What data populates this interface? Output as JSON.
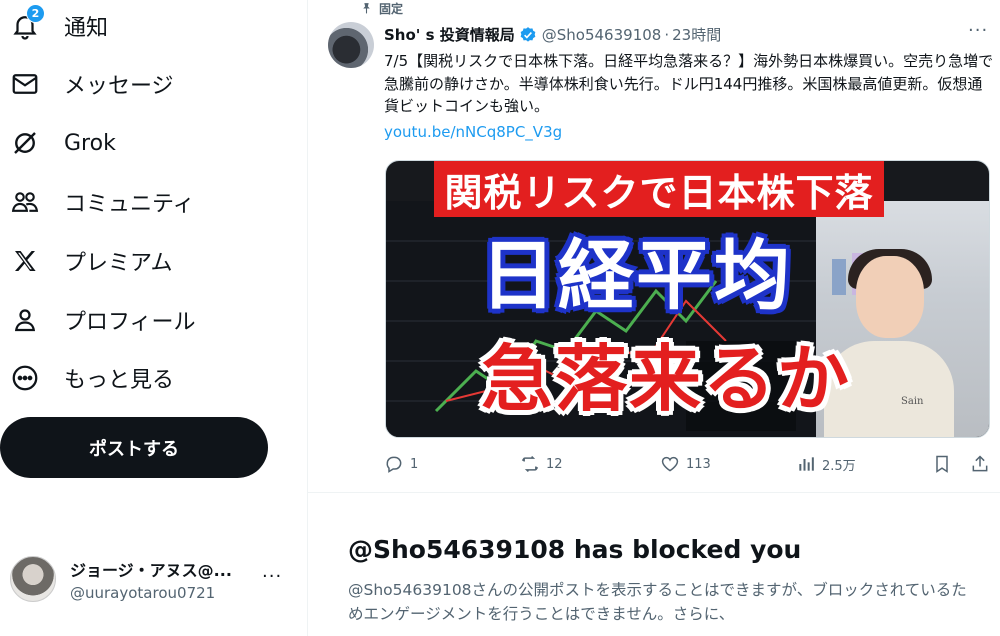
{
  "nav": {
    "notifications": {
      "label": "通知",
      "badge": "2",
      "icon": "bell-icon"
    },
    "messages": {
      "label": "メッセージ",
      "icon": "envelope-icon"
    },
    "grok": {
      "label": "Grok",
      "icon": "grok-icon"
    },
    "communities": {
      "label": "コミュニティ",
      "icon": "people-icon"
    },
    "premium": {
      "label": "プレミアム",
      "icon": "x-logo-icon"
    },
    "profile": {
      "label": "プロフィール",
      "icon": "person-icon"
    },
    "more": {
      "label": "もっと見る",
      "icon": "more-circle-icon"
    },
    "post_button": "ポストする"
  },
  "account": {
    "name": "ジョージ・アヌス@...",
    "handle": "@uurayotarou0721",
    "more": "···"
  },
  "tweet": {
    "pinned_label": "固定",
    "author_name": "Sho' s 投資情報局",
    "handle": "@Sho54639108",
    "dot": "·",
    "time": "23時間",
    "more": "···",
    "text": "7/5【関税リスクで日本株下落。日経平均急落来る？】海外勢日本株爆買い。空売り急増で急騰前の静けさか。半導体株利食い先行。ドル円144円推移。米国株最高値更新。仮想通貨ビットコインも強い。",
    "link": "youtu.be/nNCq8PC_V3g",
    "thumbnail": {
      "banner": "関税リスクで日本株下落",
      "line1": "日経平均",
      "line2": "急落来るか",
      "shirt": "Sain"
    },
    "stats": {
      "replies": "1",
      "reposts": "12",
      "likes": "113",
      "views": "2.5万"
    }
  },
  "blocked": {
    "title": "@Sho54639108 has blocked you",
    "text": "@Sho54639108さんの公開ポストを表示することはできますが、ブロックされているためエンゲージメントを行うことはできません。さらに、"
  },
  "colors": {
    "accent": "#1d9bf0",
    "text": "#0f1419",
    "muted": "#536471",
    "thumb_red": "#e31f1f",
    "thumb_blue": "#1e33c9"
  }
}
